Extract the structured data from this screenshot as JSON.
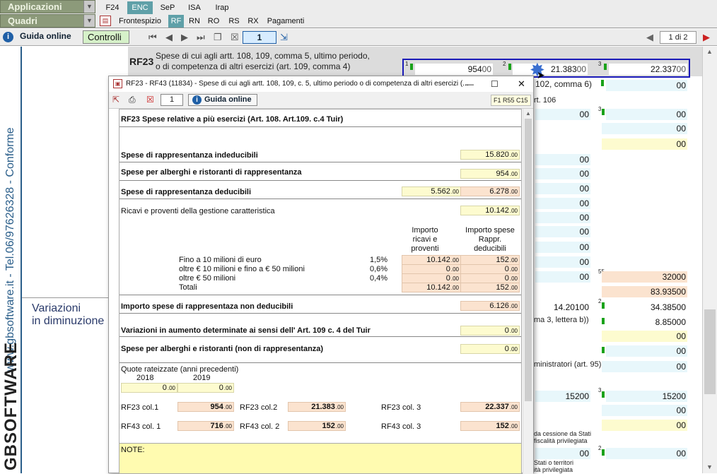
{
  "topbar": {
    "applicazioni": "Applicazioni",
    "quadri": "Quadri",
    "main_tabs": [
      "F24",
      "ENC",
      "SeP",
      "ISA",
      "Irap"
    ],
    "sub_tabs": [
      "Frontespizio",
      "RF",
      "RN",
      "RO",
      "RS",
      "RX",
      "Pagamenti"
    ]
  },
  "toolbar": {
    "guida": "Guida online",
    "controlli": "Controlli",
    "page_field": "1",
    "page_of": "1 di 2"
  },
  "left_strip": {
    "conforme": "www.gbsoftware.it - Tel.06/97626328 - Conforme",
    "logo": "GBSOFTWARE"
  },
  "background": {
    "rf23_code": "RF23",
    "rf23_desc1": "Spese di cui agli artt. 108, 109, comma 5, ultimo periodo,",
    "rf23_desc2": "o di competenza di altri esercizi (art. 109, comma 4)",
    "col1_num": "1",
    "col2_num": "2",
    "col3_num": "3",
    "rf23_col1": "954",
    "rf23_col2": "21.383",
    "rf23_col3": "22.337",
    "dec": "00",
    "row2_text": "102, comma 6)",
    "row3_text": "rt. 106",
    "variazioni1": "Variazioni",
    "variazioni2": "in diminuzione",
    "num55": "55",
    "val320": "320",
    "val83935": "83.935",
    "val14201": "14.201",
    "val34385": "34.385",
    "row_lettera": "ma 3, lettera b))",
    "val8850": "8.850",
    "row_amministratori": "ministratori (art. 95)",
    "val152a": "152",
    "val152b": "152",
    "row_cessione1": "da cessione da Stati",
    "row_cessione2": "fiscalità privilegiata",
    "row_stati1": "Stati o territori",
    "row_stati2": "ità privilegiata"
  },
  "dialog": {
    "title": "RF23 - RF43 (11834) - Spese di cui agli artt. 108, 109, c. 5, ultimo periodo o di competenza di altri esercizi (...",
    "page": "1",
    "guida": "Guida online",
    "tag": "F1 R55 C15",
    "heading": "RF23 Spese relative a più esercizi  (Art. 108. Art.109. c.4 Tuir)",
    "rows": {
      "indeducibili_label": "Spese di rappresentanza indeducibili",
      "indeducibili_val": "15.820",
      "alberghi_label": "Spese per alberghi e ristoranti di rappresentanza",
      "alberghi_val": "954",
      "deducibili_label": "Spese di rappresentanza deducibili",
      "deducibili_val1": "5.562",
      "deducibili_val2": "6.278",
      "ricavi_label": "Ricavi e proventi della gestione caratteristica",
      "ricavi_val": "10.142",
      "col_head1_l1": "Importo",
      "col_head1_l2": "ricavi e",
      "col_head1_l3": "proventi",
      "col_head2_l1": "Importo spese",
      "col_head2_l2": "Rappr.",
      "col_head2_l3": "deducibili",
      "fascia1_label": "Fino a 10 milioni di euro",
      "fascia1_pct": "1,5%",
      "fascia1_a": "10.142",
      "fascia1_b": "152",
      "fascia2_label": "oltre € 10 milioni e fino a € 50 milioni",
      "fascia2_pct": "0,6%",
      "fascia2_a": "0",
      "fascia2_b": "0",
      "fascia3_label": "oltre € 50 milioni",
      "fascia3_pct": "0,4%",
      "fascia3_a": "0",
      "fascia3_b": "0",
      "totali_label": "Totali",
      "totali_a": "10.142",
      "totali_b": "152",
      "nondeduc_label": "Importo spese di rappresentaza non deducibili",
      "nondeduc_val": "6.126",
      "variazioni_label": "Variazioni in aumento determinate ai sensi dell' Art. 109 c. 4 del Tuir",
      "variazioni_val": "0",
      "nonrappr_label": "Spese per alberghi e ristoranti (non di rappresentanza)",
      "nonrappr_val": "0",
      "quote_label": "Quote rateizzate (anni precedenti)",
      "year1": "2018",
      "year2": "2019",
      "year1_val": "0",
      "year2_val": "0",
      "rf23c1_label": "RF23 col.1",
      "rf23c1_val": "954",
      "rf23c2_label": "RF23 col.2",
      "rf23c2_val": "21.383",
      "rf23c3_label": "RF23 col. 3",
      "rf23c3_val": "22.337",
      "rf43c1_label": "RF43 col. 1",
      "rf43c1_val": "716",
      "rf43c2_label": "RF43 col. 2",
      "rf43c2_val": "152",
      "rf43c3_label": "RF43 col. 3",
      "rf43c3_val": "152",
      "dec": ".00",
      "note_label": "NOTE:"
    }
  }
}
